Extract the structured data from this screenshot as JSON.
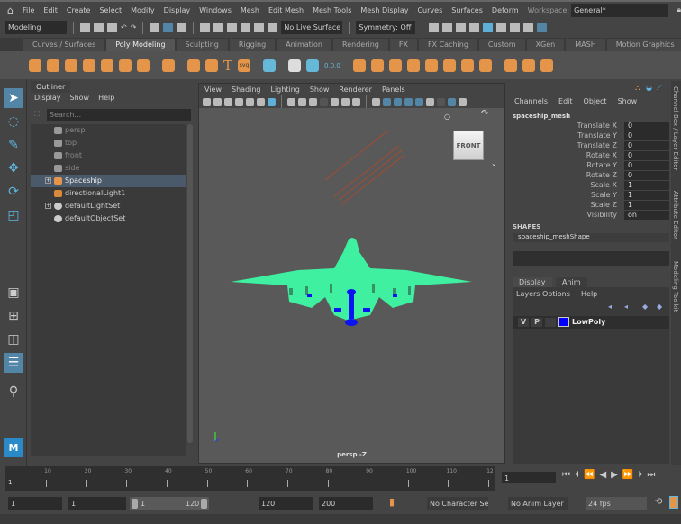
{
  "menubar": {
    "items": [
      "File",
      "Edit",
      "Create",
      "Select",
      "Modify",
      "Display",
      "Windows",
      "Mesh",
      "Edit Mesh",
      "Mesh Tools",
      "Mesh Display",
      "Curves",
      "Surfaces",
      "Deform"
    ],
    "workspace_label": "Workspace:",
    "workspace_value": "General*"
  },
  "statusline": {
    "mode": "Modeling",
    "live_surface": "No Live Surface",
    "symmetry": "Symmetry: Off"
  },
  "shelf": {
    "tabs": [
      "Curves / Surfaces",
      "Poly Modeling",
      "Sculpting",
      "Rigging",
      "Animation",
      "Rendering",
      "FX",
      "FX Caching",
      "Custom",
      "XGen",
      "MASH",
      "Motion Graphics"
    ],
    "active_tab": "Poly Modeling",
    "text_icons": {
      "type": "T",
      "svg": "svg",
      "origin": "0,0,0"
    }
  },
  "outliner": {
    "tab": "Outliner",
    "menu": [
      "Display",
      "Show",
      "Help"
    ],
    "search_placeholder": "Search...",
    "items": [
      {
        "label": "persp",
        "type": "camera",
        "dim": true
      },
      {
        "label": "top",
        "type": "camera",
        "dim": true
      },
      {
        "label": "front",
        "type": "camera",
        "dim": true
      },
      {
        "label": "side",
        "type": "camera",
        "dim": true
      },
      {
        "label": "Spaceship",
        "type": "group",
        "selected": true,
        "expandable": true
      },
      {
        "label": "directionalLight1",
        "type": "light"
      },
      {
        "label": "defaultLightSet",
        "type": "set",
        "expandable": true
      },
      {
        "label": "defaultObjectSet",
        "type": "set"
      }
    ]
  },
  "viewport": {
    "menu": [
      "View",
      "Shading",
      "Lighting",
      "Show",
      "Renderer",
      "Panels"
    ],
    "viewcube_label": "FRONT",
    "camera_label": "persp -Z",
    "mesh_color": "#3ff0a0",
    "accent_color": "#0a14f0"
  },
  "channelbox": {
    "menu": [
      "Channels",
      "Edit",
      "Object",
      "Show"
    ],
    "object": "spaceship_mesh",
    "attributes": [
      {
        "label": "Translate X",
        "value": "0"
      },
      {
        "label": "Translate Y",
        "value": "0"
      },
      {
        "label": "Translate Z",
        "value": "0"
      },
      {
        "label": "Rotate X",
        "value": "0"
      },
      {
        "label": "Rotate Y",
        "value": "0"
      },
      {
        "label": "Rotate Z",
        "value": "0"
      },
      {
        "label": "Scale X",
        "value": "1"
      },
      {
        "label": "Scale Y",
        "value": "1"
      },
      {
        "label": "Scale Z",
        "value": "1"
      },
      {
        "label": "Visibility",
        "value": "on"
      }
    ],
    "shapes_header": "SHAPES",
    "shape": "spaceship_meshShape"
  },
  "layers": {
    "tabs": [
      "Display",
      "Anim"
    ],
    "menu": [
      "Layers",
      "Options",
      "Help"
    ],
    "layer": {
      "v": "V",
      "p": "P",
      "name": "LowPoly",
      "color": "#0000ff"
    }
  },
  "side_tabs": [
    "Channel Box / Layer Editor",
    "Attribute Editor",
    "Modeling Toolkit"
  ],
  "timeline": {
    "ticks": [
      "10",
      "20",
      "30",
      "40",
      "50",
      "60",
      "70",
      "80",
      "90",
      "100",
      "110",
      "12"
    ],
    "start_label": "1",
    "current_frame": "1"
  },
  "range": {
    "start": "1",
    "playback_start": "1",
    "slider_start": "1",
    "slider_end": "120",
    "playback_end": "120",
    "end": "200",
    "character_set": "No Character Set",
    "anim_layer": "No Anim Layer",
    "fps": "24 fps"
  }
}
